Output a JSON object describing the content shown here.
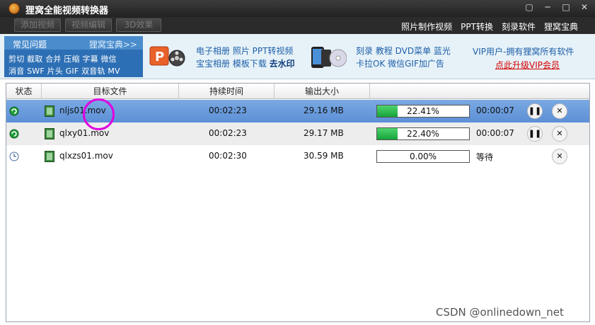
{
  "window": {
    "title": "狸窝全能视频转换器",
    "controls": [
      "minimize-icon",
      "restore-icon",
      "close-icon"
    ]
  },
  "toolbar": {
    "buttons": [
      "添加视频",
      "视频编辑",
      "3D效果"
    ],
    "links": [
      "照片制作视频",
      "PPT转换",
      "刻录软件",
      "狸窝宝典"
    ]
  },
  "promo": {
    "faq_title": "常见问题",
    "faq_more": "狸窝宝典>>",
    "faq_line1": "剪切 截取 合并 压缩 字幕 微信",
    "faq_line2": "消音 SWF 片头 GIF 双音轨 MV",
    "block1_line1": "电子相册 照片 PPT转视频",
    "block1_line2a": "宝宝相册 模板下载 ",
    "block1_line2b": "去水印",
    "block2_line1": "刻录 教程 DVD菜单 蓝光",
    "block2_line2": "卡拉OK 微信GIF加广告",
    "vip_text": "VIP用户-拥有狸窝所有软件",
    "vip_link": "点此升级VIP会员"
  },
  "table": {
    "headers": [
      "状态",
      "目标文件",
      "持续时间",
      "输出大小",
      ""
    ],
    "rows": [
      {
        "status_icon": "converting-icon",
        "file": "nljs01.mov",
        "duration": "00:02:23",
        "size": "29.16 MB",
        "progress": 22.41,
        "progress_label": "22.41%",
        "time": "00:00:07",
        "pause_icon": "pause-icon",
        "close_icon": "close-icon"
      },
      {
        "status_icon": "converting-icon",
        "file": "qlxy01.mov",
        "duration": "00:02:23",
        "size": "29.17 MB",
        "progress": 22.4,
        "progress_label": "22.40%",
        "time": "00:00:07",
        "pause_icon": "pause-icon",
        "close_icon": "close-icon"
      },
      {
        "status_icon": "clock-icon",
        "file": "qlxzs01.mov",
        "duration": "00:02:30",
        "size": "30.59 MB",
        "progress": 0,
        "progress_label": "0.00%",
        "time": "等待",
        "close_icon": "close-icon"
      }
    ]
  },
  "watermark": "CSDN @onlinedown_net",
  "colors": {
    "selected_row": "#6a9adc",
    "progress_green": "#22b347",
    "annotation": "#e000e0",
    "vip_red": "#d40000"
  }
}
